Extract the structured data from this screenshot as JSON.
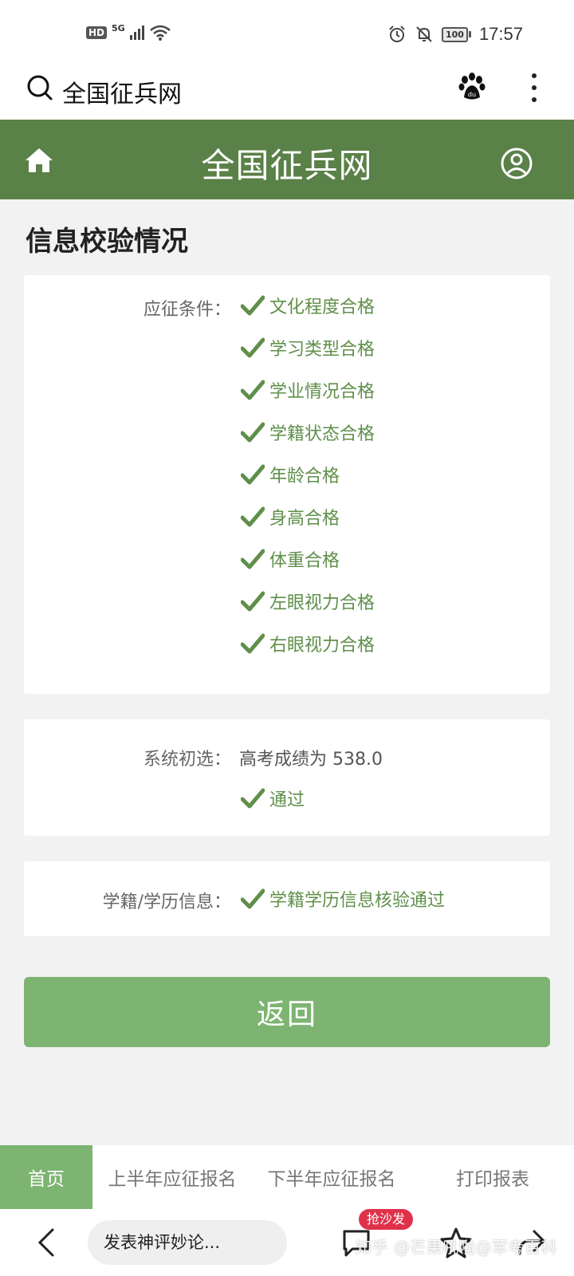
{
  "status_bar": {
    "hd": "HD",
    "network": "5G",
    "battery": "100",
    "time": "17:57"
  },
  "browser": {
    "search_text": "全国征兵网"
  },
  "header": {
    "title": "全国征兵网"
  },
  "page": {
    "title": "信息校验情况"
  },
  "conditions": {
    "label": "应征条件：",
    "items": [
      "文化程度合格",
      "学习类型合格",
      "学业情况合格",
      "学籍状态合格",
      "年龄合格",
      "身高合格",
      "体重合格",
      "左眼视力合格",
      "右眼视力合格"
    ]
  },
  "screening": {
    "label": "系统初选：",
    "score_text": "高考成绩为 538.0",
    "result": "通过"
  },
  "education": {
    "label": "学籍/学历信息：",
    "result": "学籍学历信息核验通过"
  },
  "back_button": "返回",
  "site_nav": {
    "tabs": [
      "首页",
      "上半年应征报名",
      "下半年应征报名",
      "打印报表"
    ],
    "active": 0
  },
  "browser_bottom": {
    "comment_placeholder": "发表神评妙论...",
    "badge": "抢沙发",
    "watermark": "知乎 @芒果吼啦@军考百科"
  },
  "colors": {
    "header_green": "#5a8148",
    "accent_green": "#7db471",
    "check_green": "#5f8f4a"
  }
}
